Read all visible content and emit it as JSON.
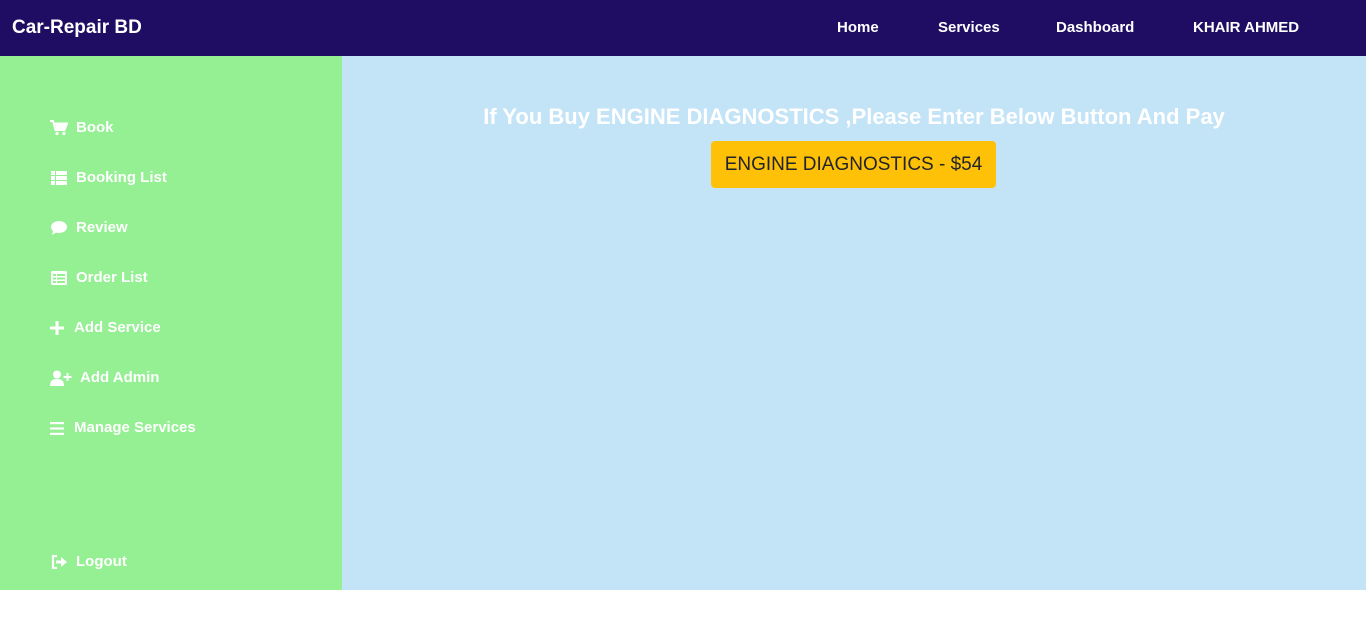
{
  "header": {
    "brand": "Car-Repair BD",
    "nav": [
      "Home",
      "Services",
      "Dashboard",
      "KHAIR AHMED"
    ]
  },
  "sidebar": {
    "items": [
      {
        "label": "Book",
        "icon": "cart-icon"
      },
      {
        "label": "Booking List",
        "icon": "list-grid-icon"
      },
      {
        "label": "Review",
        "icon": "comment-icon"
      },
      {
        "label": "Order List",
        "icon": "table-list-icon"
      },
      {
        "label": "Add Service",
        "icon": "plus-icon"
      },
      {
        "label": "Add Admin",
        "icon": "user-plus-icon"
      },
      {
        "label": "Manage Services",
        "icon": "menu-bars-icon"
      }
    ],
    "logout": {
      "label": "Logout",
      "icon": "sign-out-icon"
    }
  },
  "main": {
    "headline": "If You Buy ENGINE DIAGNOSTICS ,Please Enter Below Button And Pay",
    "pay_button": "ENGINE DIAGNOSTICS - $54"
  },
  "colors": {
    "header_bg": "#1f0d63",
    "sidebar_bg": "#95ef93",
    "main_bg": "#c3e3f7",
    "button_bg": "#ffc107"
  }
}
